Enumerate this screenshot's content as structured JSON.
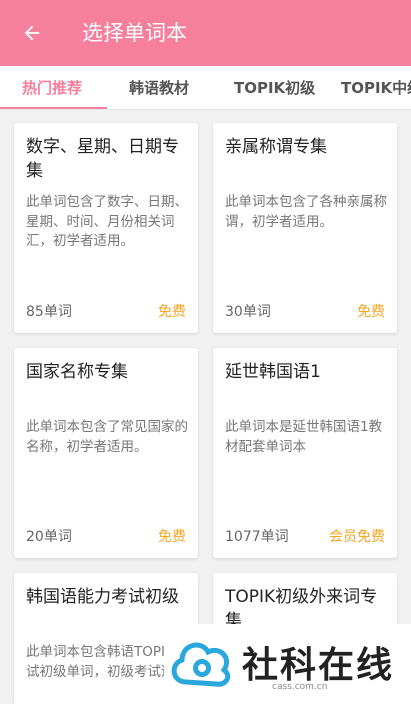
{
  "header": {
    "title": "选择单词本"
  },
  "tabs": [
    {
      "label": "热门推荐"
    },
    {
      "label": "韩语教材"
    },
    {
      "label": "TOPIK初级"
    },
    {
      "label": "TOPIK中级"
    }
  ],
  "cards": [
    {
      "title": "数字、星期、日期专集",
      "desc": "此单词包含了数字、日期、星期、时间、月份相关词汇，初学者适用。",
      "count": "85单词",
      "price": "免费"
    },
    {
      "title": "亲属称谓专集",
      "desc": "此单词本包含了各种亲属称谓，初学者适用。",
      "count": "30单词",
      "price": "免费"
    },
    {
      "title": "国家名称专集",
      "desc": "此单词本包含了常见国家的名称，初学者适用。",
      "count": "20单词",
      "price": "免费"
    },
    {
      "title": "延世韩国语1",
      "desc": "此单词本是延世韩国语1教材配套单词本",
      "count": "1077单词",
      "price": "会员免费"
    },
    {
      "title": "韩国语能力考试初级",
      "desc": "此单词本包含韩语TOPIK考试初级单词，初级考试适用",
      "count": "",
      "price": ""
    },
    {
      "title": "TOPIK初级外来词专集",
      "desc": "",
      "count": "",
      "price": ""
    }
  ],
  "watermark": {
    "text": "社科在线",
    "sub": "cass.com.cn"
  },
  "colors": {
    "accent": "#f57f9c",
    "price": "#f4a623"
  }
}
